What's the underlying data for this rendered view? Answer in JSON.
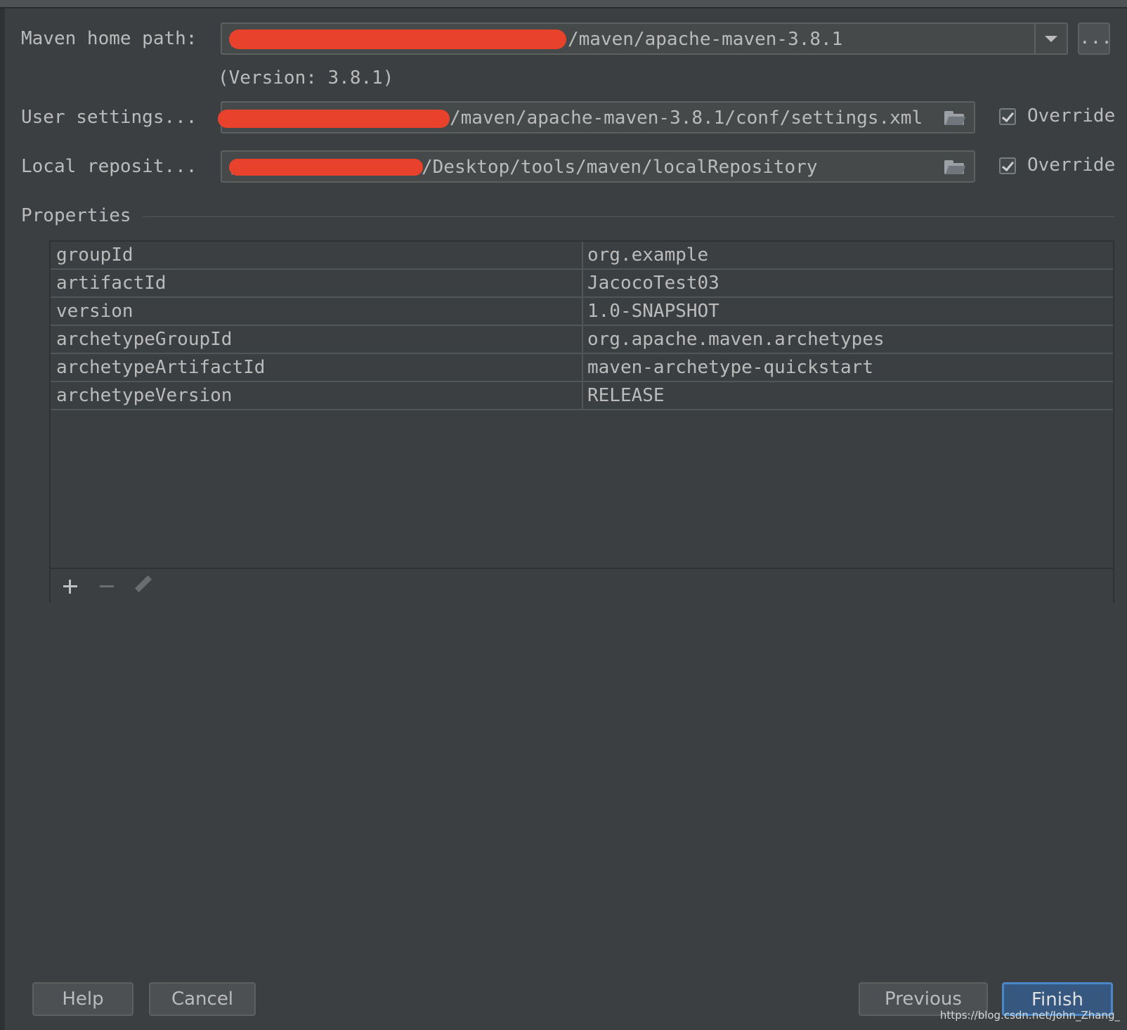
{
  "form": {
    "maven_home": {
      "label": "Maven home path:",
      "value_visible": "/maven/apache-maven-3.8.1",
      "version": "(Version: 3.8.1)",
      "browse_label": "..."
    },
    "user_settings": {
      "label": "User settings...",
      "value_visible": "/maven/apache-maven-3.8.1/conf/settings.xml",
      "override_label": "Override",
      "override_checked": true
    },
    "local_repo": {
      "label": "Local reposit...",
      "value_visible": "/Desktop/tools/maven/localRepository",
      "override_label": "Override",
      "override_checked": true
    }
  },
  "properties": {
    "title": "Properties",
    "rows": [
      {
        "key": "groupId",
        "value": "org.example"
      },
      {
        "key": "artifactId",
        "value": "JacocoTest03"
      },
      {
        "key": "version",
        "value": "1.0-SNAPSHOT"
      },
      {
        "key": "archetypeGroupId",
        "value": "org.apache.maven.archetypes"
      },
      {
        "key": "archetypeArtifactId",
        "value": "maven-archetype-quickstart"
      },
      {
        "key": "archetypeVersion",
        "value": "RELEASE"
      }
    ],
    "toolbar_icons": [
      "plus-icon",
      "minus-icon",
      "pencil-icon"
    ]
  },
  "buttons": {
    "help": "Help",
    "cancel": "Cancel",
    "previous": "Previous",
    "finish": "Finish"
  },
  "watermark": "https://blog.csdn.net/John_Zhang_",
  "colors": {
    "background": "#3c3f41",
    "primary_button": "#365880",
    "redaction": "#e8412c"
  }
}
